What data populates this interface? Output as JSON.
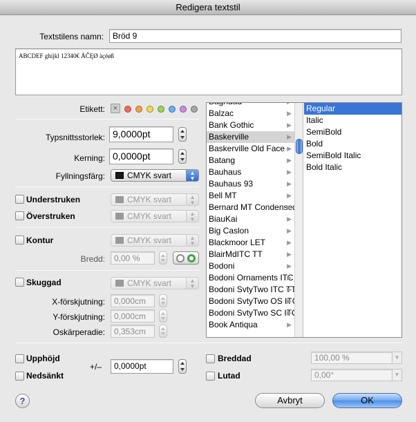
{
  "window": {
    "title": "Redigera textstil"
  },
  "name": {
    "label": "Textstilens namn:",
    "value": "Bröd 9"
  },
  "preview": {
    "text": "ABCDEF ghijkl 12340€ ÅČĘØ àçéøß"
  },
  "etikett": {
    "label": "Etikett:",
    "colors": [
      "#f26a5f",
      "#f5a04a",
      "#f0da54",
      "#9ed35a",
      "#66b2f0",
      "#c78de0",
      "#a8a8a8"
    ]
  },
  "size": {
    "label": "Typsnittsstorlek:",
    "value": "9,0000pt"
  },
  "kerning": {
    "label": "Kerning:",
    "value": "0,0000pt"
  },
  "fill": {
    "label": "Fyllningsfärg:",
    "value": "CMYK svart"
  },
  "underline": {
    "label": "Understruken",
    "value": "CMYK svart"
  },
  "strike": {
    "label": "Överstruken",
    "value": "CMYK svart"
  },
  "outline": {
    "label": "Kontur",
    "value": "CMYK svart",
    "width_label": "Bredd:",
    "width_value": "0,00 %"
  },
  "shadow": {
    "label": "Skuggad",
    "value": "CMYK svart",
    "x_label": "X-förskjutning:",
    "x_value": "0,000cm",
    "y_label": "Y-förskjutning:",
    "y_value": "0,000cm",
    "blur_label": "Oskärperadie:",
    "blur_value": "0,353cm"
  },
  "fonts": [
    "Baghdad",
    "Balzac",
    "Bank Gothic",
    "Baskerville",
    "Baskerville Old Face",
    "Batang",
    "Bauhaus",
    "Bauhaus 93",
    "Bell MT",
    "Bernard MT Condensed",
    "BiauKai",
    "Big Caslon",
    "Blackmoor LET",
    "BlairMdITC TT",
    "Bodoni",
    "Bodoni Ornaments ITC",
    "Bodoni SvtyTwo ITC TT",
    "Bodoni SvtyTwo OS ITC",
    "Bodoni SvtyTwo SC ITC",
    "Book Antiqua"
  ],
  "styles": [
    "Regular",
    "Italic",
    "SemiBold",
    "Bold",
    "SemiBold Italic",
    "Bold Italic"
  ],
  "superscript": {
    "label": "Upphöjd"
  },
  "subscript": {
    "label": "Nedsänkt"
  },
  "offset": {
    "label": "+/–",
    "value": "0,0000pt"
  },
  "wide": {
    "label": "Breddad",
    "value": "100,00 %"
  },
  "italic": {
    "label": "Lutad",
    "value": "0,00°"
  },
  "buttons": {
    "help": "?",
    "cancel": "Avbryt",
    "ok": "OK"
  }
}
